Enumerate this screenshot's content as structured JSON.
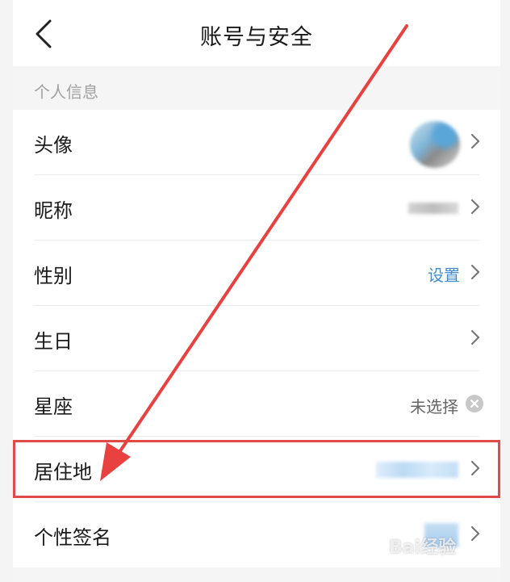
{
  "header": {
    "title": "账号与安全"
  },
  "section": {
    "label": "个人信息"
  },
  "rows": [
    {
      "label": "头像",
      "value": ""
    },
    {
      "label": "昵称",
      "value": ""
    },
    {
      "label": "性别",
      "value": "设置"
    },
    {
      "label": "生日",
      "value": ""
    },
    {
      "label": "星座",
      "value": "未选择"
    },
    {
      "label": "居住地",
      "value": ""
    },
    {
      "label": "个性签名",
      "value": ""
    }
  ],
  "watermark": {
    "text": "Bai经验"
  },
  "colors": {
    "link": "#3e8ed0",
    "highlight": "#e04a4a",
    "arrow": "#e8413f"
  }
}
